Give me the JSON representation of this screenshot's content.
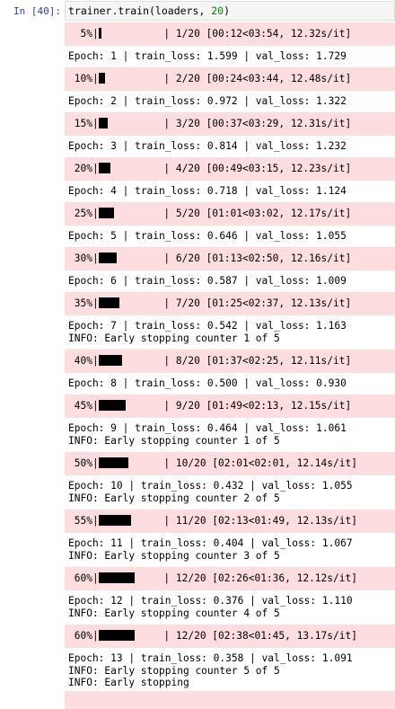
{
  "cell": {
    "prompt": "In [40]:",
    "code_prefix": "trainer.train(loaders, ",
    "code_arg": "20",
    "code_suffix": ")"
  },
  "output": [
    {
      "type": "progress",
      "percent": "5%",
      "fraction": 0.05,
      "text": "| 1/20 [00:12<03:54, 12.32s/it]"
    },
    {
      "type": "log",
      "lines": [
        "Epoch: 1 | train_loss: 1.599 | val_loss: 1.729"
      ]
    },
    {
      "type": "progress",
      "percent": "10%",
      "fraction": 0.1,
      "text": "| 2/20 [00:24<03:44, 12.48s/it]"
    },
    {
      "type": "log",
      "lines": [
        "Epoch: 2 | train_loss: 0.972 | val_loss: 1.322"
      ]
    },
    {
      "type": "progress",
      "percent": "15%",
      "fraction": 0.15,
      "text": "| 3/20 [00:37<03:29, 12.31s/it]"
    },
    {
      "type": "log",
      "lines": [
        "Epoch: 3 | train_loss: 0.814 | val_loss: 1.232"
      ]
    },
    {
      "type": "progress",
      "percent": "20%",
      "fraction": 0.2,
      "text": "| 4/20 [00:49<03:15, 12.23s/it]"
    },
    {
      "type": "log",
      "lines": [
        "Epoch: 4 | train_loss: 0.718 | val_loss: 1.124"
      ]
    },
    {
      "type": "progress",
      "percent": "25%",
      "fraction": 0.25,
      "text": "| 5/20 [01:01<03:02, 12.17s/it]"
    },
    {
      "type": "log",
      "lines": [
        "Epoch: 5 | train_loss: 0.646 | val_loss: 1.055"
      ]
    },
    {
      "type": "progress",
      "percent": "30%",
      "fraction": 0.3,
      "text": "| 6/20 [01:13<02:50, 12.16s/it]"
    },
    {
      "type": "log",
      "lines": [
        "Epoch: 6 | train_loss: 0.587 | val_loss: 1.009"
      ]
    },
    {
      "type": "progress",
      "percent": "35%",
      "fraction": 0.35,
      "text": "| 7/20 [01:25<02:37, 12.13s/it]"
    },
    {
      "type": "log",
      "lines": [
        "Epoch: 7 | train_loss: 0.542 | val_loss: 1.163",
        "INFO: Early stopping counter 1 of 5"
      ]
    },
    {
      "type": "progress",
      "percent": "40%",
      "fraction": 0.4,
      "text": "| 8/20 [01:37<02:25, 12.11s/it]"
    },
    {
      "type": "log",
      "lines": [
        "Epoch: 8 | train_loss: 0.500 | val_loss: 0.930"
      ]
    },
    {
      "type": "progress",
      "percent": "45%",
      "fraction": 0.45,
      "text": "| 9/20 [01:49<02:13, 12.15s/it]"
    },
    {
      "type": "log",
      "lines": [
        "Epoch: 9 | train_loss: 0.464 | val_loss: 1.061",
        "INFO: Early stopping counter 1 of 5"
      ]
    },
    {
      "type": "progress",
      "percent": "50%",
      "fraction": 0.5,
      "text": "| 10/20 [02:01<02:01, 12.14s/it]"
    },
    {
      "type": "log",
      "lines": [
        "Epoch: 10 | train_loss: 0.432 | val_loss: 1.055",
        "INFO: Early stopping counter 2 of 5"
      ]
    },
    {
      "type": "progress",
      "percent": "55%",
      "fraction": 0.55,
      "text": "| 11/20 [02:13<01:49, 12.13s/it]"
    },
    {
      "type": "log",
      "lines": [
        "Epoch: 11 | train_loss: 0.404 | val_loss: 1.067",
        "INFO: Early stopping counter 3 of 5"
      ]
    },
    {
      "type": "progress",
      "percent": "60%",
      "fraction": 0.6,
      "text": "| 12/20 [02:26<01:36, 12.12s/it]"
    },
    {
      "type": "log",
      "lines": [
        "Epoch: 12 | train_loss: 0.376 | val_loss: 1.110",
        "INFO: Early stopping counter 4 of 5"
      ]
    },
    {
      "type": "progress",
      "percent": "60%",
      "fraction": 0.6,
      "text": "| 12/20 [02:38<01:45, 13.17s/it]"
    },
    {
      "type": "log",
      "lines": [
        "Epoch: 13 | train_loss: 0.358 | val_loss: 1.091",
        "INFO: Early stopping counter 5 of 5",
        "INFO: Early stopping"
      ]
    }
  ],
  "colors": {
    "stderr_bg": "#fddddd",
    "prompt": "#303f9f",
    "number": "#008800"
  }
}
